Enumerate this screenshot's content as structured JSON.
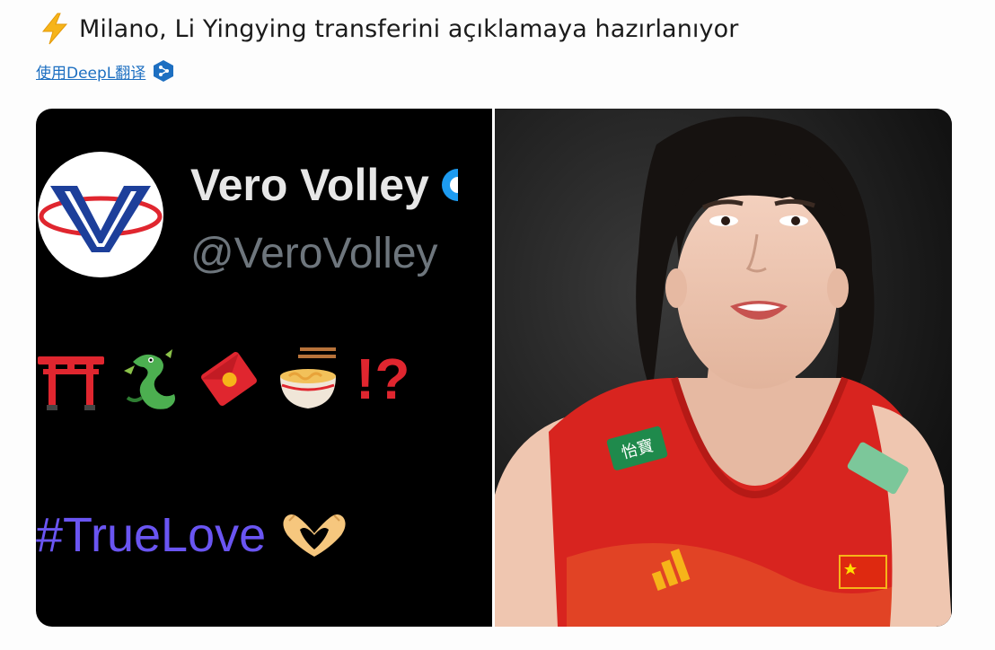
{
  "tweet": {
    "icon": "high-voltage-emoji",
    "text": "Milano, Li Yingying transferini açıklamaya hazırlanıyor",
    "translate_label": "使用DeepL翻译",
    "translate_icon": "deepl-icon"
  },
  "media_left": {
    "display_name": "Vero Volley",
    "handle": "@VeroVolley",
    "emojis": [
      "shinto-shrine-emoji",
      "dragon-emoji",
      "red-envelope-emoji",
      "steaming-bowl-emoji"
    ],
    "punctuation": "!?",
    "hashtag": "#TrueLove",
    "hands_icon": "heart-hands-emoji",
    "colors": {
      "logo_blue": "#1d3f9a",
      "logo_red": "#e0262f",
      "hashtag": "#6a55f2",
      "verified": "#1d9bf0"
    }
  },
  "media_right": {
    "subject": "volleyball-player-photo",
    "jersey_sponsor": "怡寶",
    "colors": {
      "jersey": "#d8241f",
      "background": "#141414"
    }
  }
}
